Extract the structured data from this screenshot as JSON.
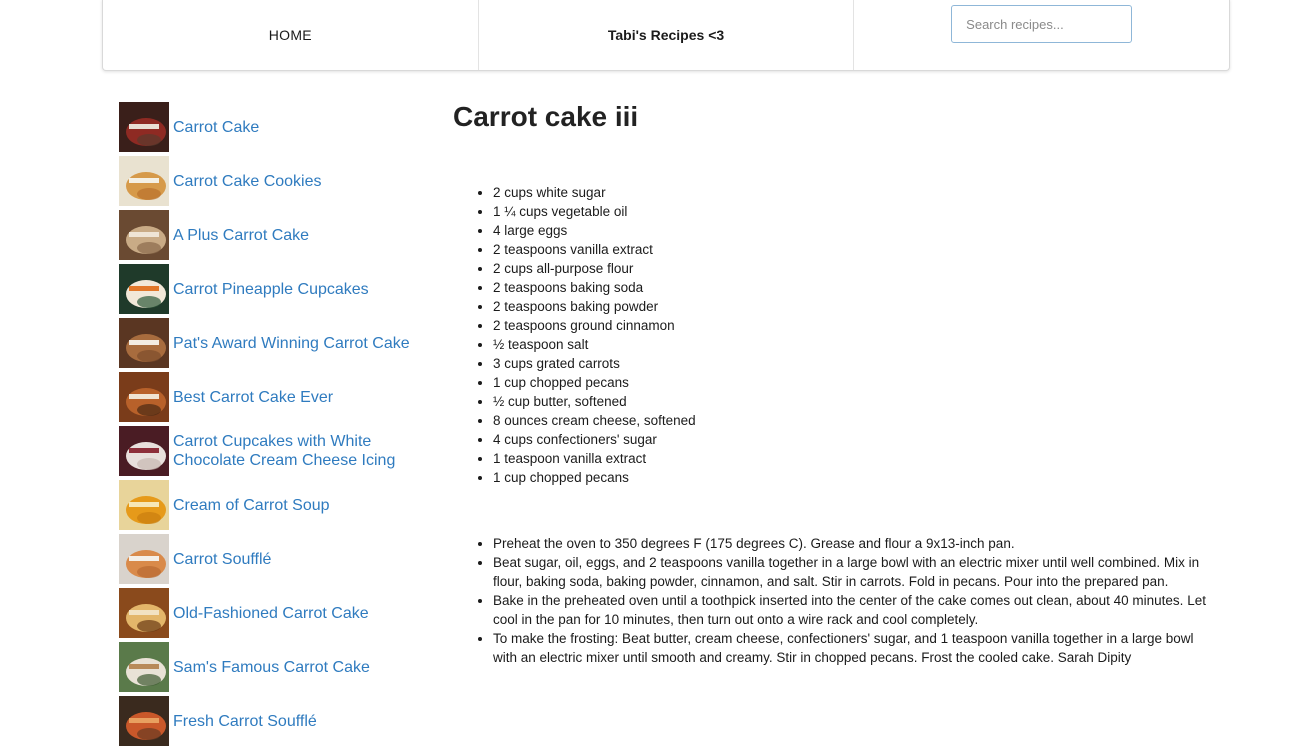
{
  "nav": {
    "home_label": "HOME",
    "brand": "Tabi's Recipes <3",
    "search_placeholder": "Search recipes..."
  },
  "sidebar": {
    "items": [
      {
        "label": "Carrot Cake",
        "thumb": "red velvet cake slice"
      },
      {
        "label": "Carrot Cake Cookies",
        "thumb": "frosted cookies"
      },
      {
        "label": "A Plus Carrot Cake",
        "thumb": "cake slice"
      },
      {
        "label": "Carrot Pineapple Cupcakes",
        "thumb": "cupcakes with carrot decorations"
      },
      {
        "label": "Pat's Award Winning Carrot Cake",
        "thumb": "layered cake"
      },
      {
        "label": "Best Carrot Cake Ever",
        "thumb": "carrot cake slice"
      },
      {
        "label": "Carrot Cupcakes with White Chocolate Cream Cheese Icing",
        "thumb": "frosted cupcakes"
      },
      {
        "label": "Cream of Carrot Soup",
        "thumb": "soup bowl"
      },
      {
        "label": "Carrot Soufflé",
        "thumb": "souffle ramekin"
      },
      {
        "label": "Old-Fashioned Carrot Cake",
        "thumb": "cake square"
      },
      {
        "label": "Sam's Famous Carrot Cake",
        "thumb": "cake on plate"
      },
      {
        "label": "Fresh Carrot Soufflé",
        "thumb": "souffle dish"
      }
    ]
  },
  "recipe": {
    "title": "Carrot cake iii",
    "ingredients": [
      "2 cups white sugar",
      "1 ¼ cups vegetable oil",
      "4 large eggs",
      "2 teaspoons vanilla extract",
      "2 cups all-purpose flour",
      "2 teaspoons baking soda",
      "2 teaspoons baking powder",
      "2 teaspoons ground cinnamon",
      "½ teaspoon salt",
      "3 cups grated carrots",
      "1 cup chopped pecans",
      "½ cup butter, softened",
      "8 ounces cream cheese, softened",
      "4 cups confectioners' sugar",
      "1 teaspoon vanilla extract",
      "1 cup chopped pecans"
    ],
    "steps": [
      "Preheat the oven to 350 degrees F (175 degrees C). Grease and flour a 9x13-inch pan.",
      "Beat sugar, oil, eggs, and 2 teaspoons vanilla together in a large bowl with an electric mixer until well combined. Mix in flour, baking soda, baking powder, cinnamon, and salt. Stir in carrots. Fold in pecans. Pour into the prepared pan.",
      "Bake in the preheated oven until a toothpick inserted into the center of the cake comes out clean, about 40 minutes. Let cool in the pan for 10 minutes, then turn out onto a wire rack and cool completely.",
      "To make the frosting: Beat butter, cream cheese, confectioners' sugar, and 1 teaspoon vanilla together in a large bowl with an electric mixer until smooth and creamy. Stir in chopped pecans. Frost the cooled cake. Sarah Dipity"
    ]
  }
}
